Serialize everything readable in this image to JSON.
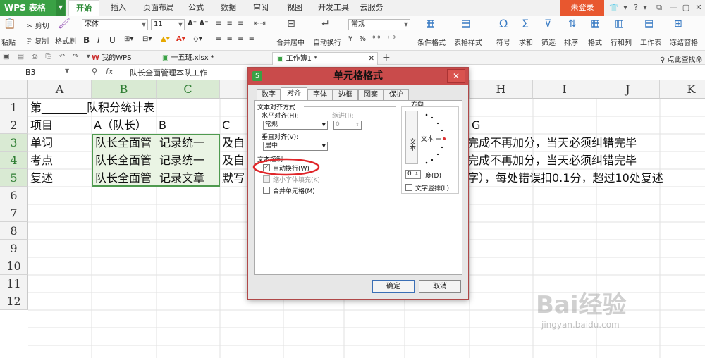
{
  "app": {
    "name": "WPS 表格",
    "login": "未登录"
  },
  "menu_tabs": [
    "开始",
    "插入",
    "页面布局",
    "公式",
    "数据",
    "审阅",
    "视图",
    "开发工具",
    "云服务"
  ],
  "ribbon": {
    "paste": "粘贴",
    "cut": "剪切",
    "copy": "复制",
    "format_painter": "格式刷",
    "font": "宋体",
    "font_size": "11",
    "merge_center": "合并居中",
    "wrap": "自动换行",
    "number_format": "常规",
    "conditional": "条件格式",
    "table_style": "表格样式",
    "symbol": "符号",
    "sum": "求和",
    "filter": "筛选",
    "sort": "排序",
    "format": "格式",
    "row_col": "行和列",
    "worksheet": "工作表",
    "freeze": "冻结窗格",
    "find": "点此查找命"
  },
  "doc_tabs": [
    "我的WPS",
    "一五班.xlsx *",
    "工作簿1 *"
  ],
  "formula_bar": {
    "cell_ref": "B3",
    "fx": "fx",
    "content": "队长全面管理本队工作"
  },
  "columns": [
    "A",
    "B",
    "C",
    "D",
    "E",
    "F",
    "G",
    "H",
    "I",
    "J",
    "K"
  ],
  "rows": [
    "1",
    "2",
    "3",
    "4",
    "5",
    "6",
    "7",
    "8",
    "9",
    "10",
    "11",
    "12"
  ],
  "cells": {
    "A1": "第________队积分统计表",
    "A2": "项目",
    "B2": "A（队长）",
    "C2": "B",
    "D2": "C",
    "G2": "G",
    "A3": "单词",
    "B3": "队长全面管",
    "C3": "记录统一",
    "D3": "及自",
    "A4": "考点",
    "B4": "队长全面管",
    "C4": "记录统一",
    "D4": "及自",
    "A5": "复述",
    "B5": "队长全面管",
    "C5": "记录文章",
    "D5": "默写",
    "G3": "完成不再加分，当天必须纠错完毕",
    "G4": "完成不再加分，当天必须纠错完毕",
    "G5": "字），每处错误扣0.1分，超过10处复述"
  },
  "dialog": {
    "title": "单元格格式",
    "tabs": [
      "数字",
      "对齐",
      "字体",
      "边框",
      "图案",
      "保护"
    ],
    "text_align_group": "文本对齐方式",
    "horizontal_label": "水平对齐(H):",
    "horizontal_value": "常规",
    "indent_label": "缩进(I):",
    "indent_value": "0",
    "vertical_label": "垂直对齐(V):",
    "vertical_value": "居中",
    "text_control_group": "文本控制",
    "wrap_text": "自动换行(W)",
    "shrink": "缩小字体填充(K)",
    "merge": "合并单元格(M)",
    "orientation_group": "方向",
    "vertical_text": "文本",
    "orient_text": "文本",
    "degree_value": "0",
    "degree_label": "度(D)",
    "vertical_stack": "文字竖排(L)",
    "ok": "确定",
    "cancel": "取消"
  },
  "watermark": {
    "brand": "Bai经验",
    "url": "jingyan.baidu.com"
  },
  "colors": {
    "green": "#3aa145",
    "dialog_title": "#c94b4b",
    "login": "#e8572f",
    "highlight_ring": "#e0262a"
  }
}
